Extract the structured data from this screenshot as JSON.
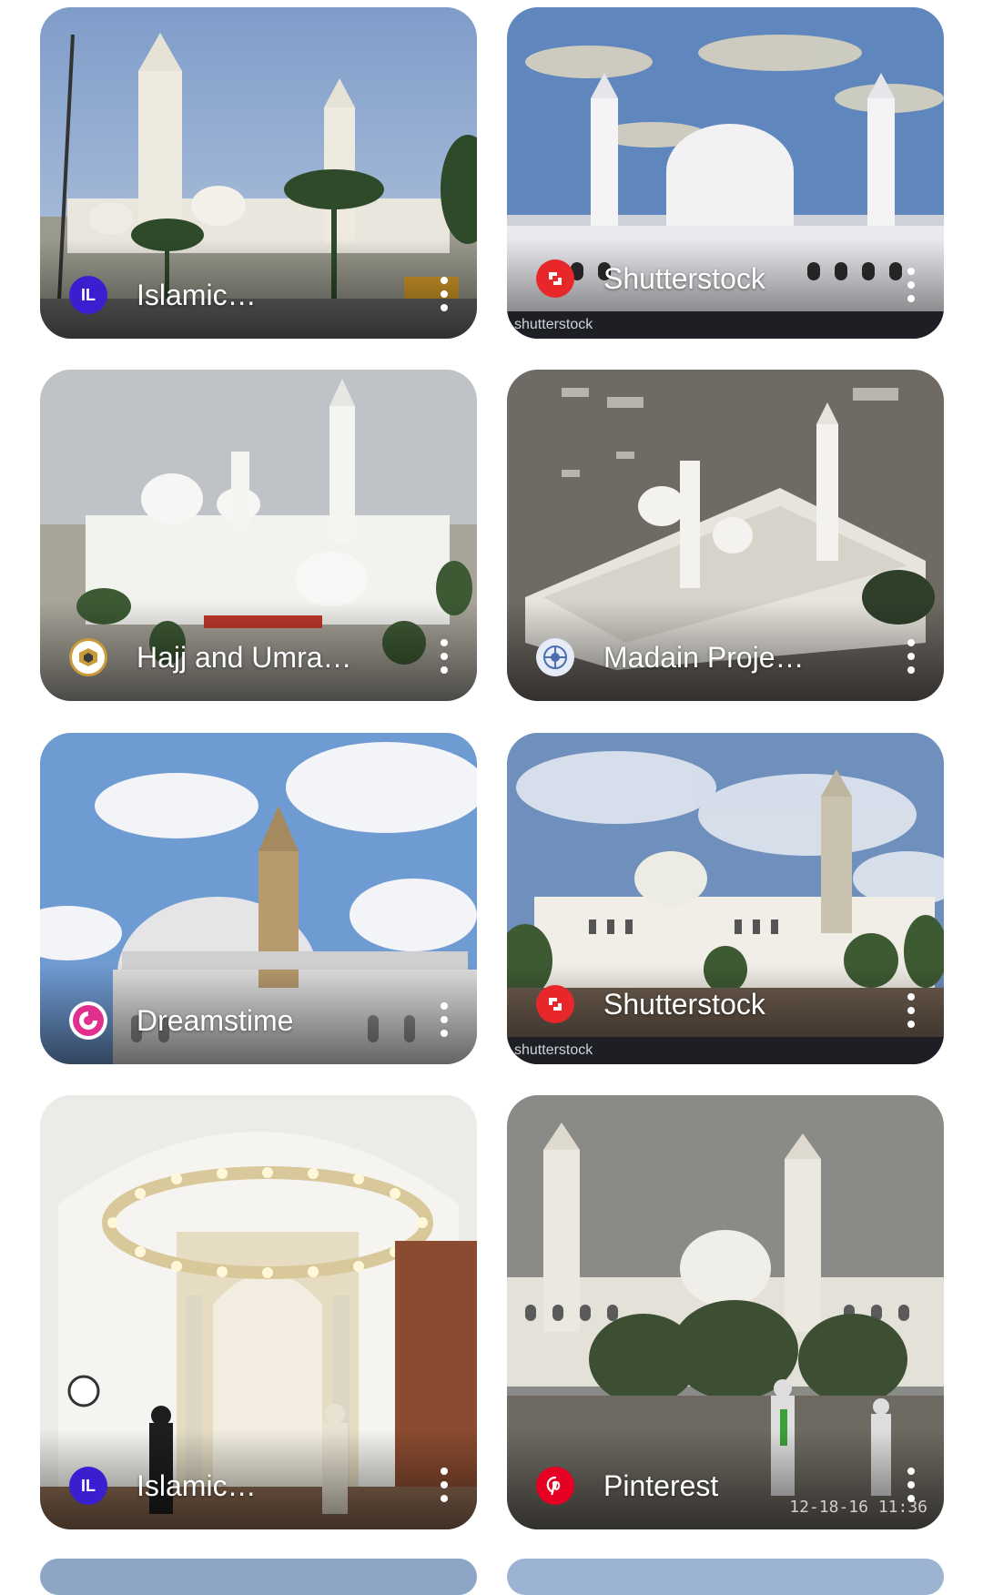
{
  "results": [
    {
      "source": "Islamic…",
      "icon": "il-logo-icon",
      "icon_text": "IL",
      "icon_color": "#3a1fd1"
    },
    {
      "source": "Shutterstock",
      "icon": "shutterstock-logo-icon",
      "icon_color": "#e8272b",
      "watermark_bar": "shutterstock"
    },
    {
      "source": "Hajj and Umra…",
      "icon": "hajj-umrah-logo-icon",
      "icon_color": "#c99b3a"
    },
    {
      "source": "Madain Proje…",
      "icon": "madain-logo-icon",
      "icon_color": "#4a6fb0"
    },
    {
      "source": "Dreamstime",
      "icon": "dreamstime-logo-icon",
      "icon_color": "#e02f8c"
    },
    {
      "source": "Shutterstock",
      "icon": "shutterstock-logo-icon",
      "icon_color": "#e8272b",
      "watermark_bar": "shutterstock"
    },
    {
      "source": "Islamic…",
      "icon": "il-logo-icon",
      "icon_text": "IL",
      "icon_color": "#3a1fd1"
    },
    {
      "source": "Pinterest",
      "icon": "pinterest-logo-icon",
      "icon_color": "#e60023",
      "timestamp": "12-18-16 11:36"
    }
  ]
}
